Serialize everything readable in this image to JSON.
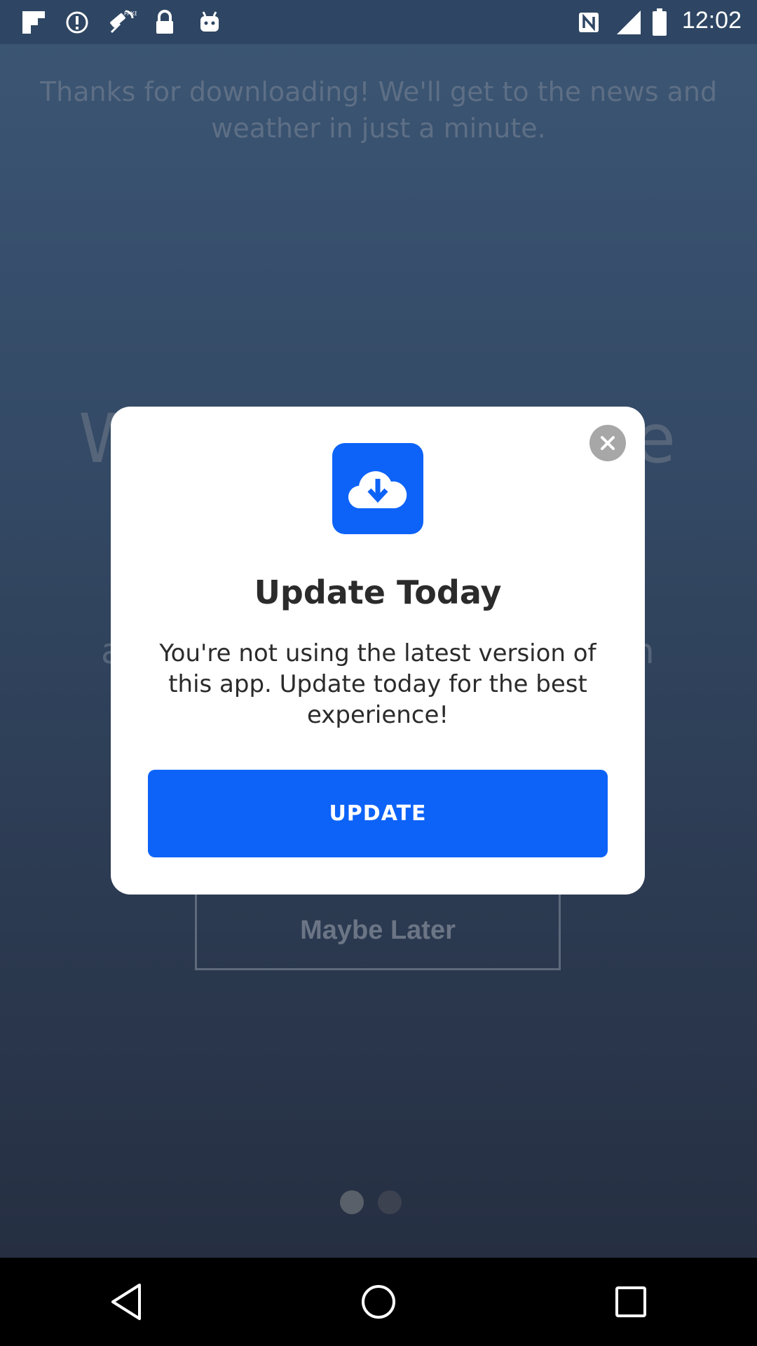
{
  "status_bar": {
    "time": "12:02",
    "icons": [
      "flipboard-icon",
      "circle-exclaim-icon",
      "fake-gps-icon",
      "lock-icon",
      "android-icon",
      "nfc-icon",
      "signal-icon",
      "battery-icon"
    ]
  },
  "background": {
    "intro_text": "Thanks for downloading! We'll get to the news and weather in just a minute.",
    "heading_fragment_left": "W",
    "heading_fragment_right": "e",
    "sub_fragment_left": "a",
    "sub_fragment_right": "n",
    "maybe_later_label": "Maybe Later",
    "page_dots": {
      "count": 2,
      "active_index": 0
    }
  },
  "modal": {
    "title": "Update Today",
    "body": "You're not using the latest version of this app. Update today for the best experience!",
    "update_label": "UPDATE",
    "icon": "cloud-download-icon",
    "close_icon": "close-icon"
  },
  "nav_bar": {
    "icons": [
      "back-icon",
      "home-icon",
      "recents-icon"
    ]
  },
  "colors": {
    "accent": "#0D63F8",
    "backdrop_top": "#3B5674",
    "backdrop_bottom": "#262F42",
    "modal_bg": "#FFFFFF",
    "close_bg": "#A7A7A7"
  }
}
